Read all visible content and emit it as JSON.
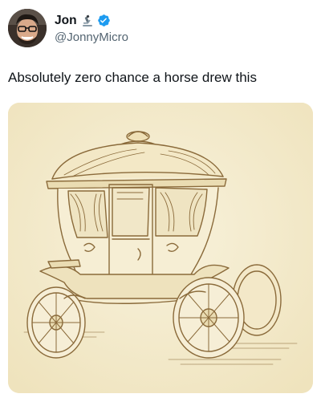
{
  "author": {
    "display_name": "Jon",
    "handle": "@JonnyMicro",
    "name_emoji": "microscope-icon",
    "verified": true
  },
  "tweet": {
    "text": "Absolutely zero chance a horse drew this"
  },
  "media": {
    "subject": "carriage-illustration"
  },
  "colors": {
    "text_primary": "#0f1419",
    "text_secondary": "#536471",
    "verified_blue": "#1d9bf0",
    "paper": "#f5edcf",
    "ink": "#8a6a3a"
  }
}
